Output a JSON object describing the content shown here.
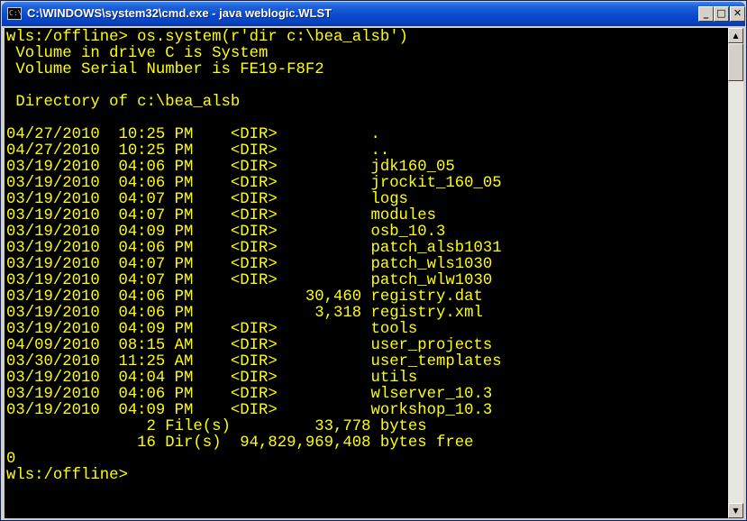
{
  "window": {
    "icon_label": "C:\\",
    "title": "C:\\WINDOWS\\system32\\cmd.exe - java weblogic.WLST",
    "buttons": {
      "minimize": "_",
      "maximize": "□",
      "close": "✕"
    }
  },
  "console": {
    "text_color": "#ffff00",
    "background_color": "#000000",
    "lines": [
      "wls:/offline> os.system(r'dir c:\\bea_alsb')",
      " Volume in drive C is System",
      " Volume Serial Number is FE19-F8F2",
      "",
      " Directory of c:\\bea_alsb",
      "",
      "04/27/2010  10:25 PM    <DIR>          .",
      "04/27/2010  10:25 PM    <DIR>          ..",
      "03/19/2010  04:06 PM    <DIR>          jdk160_05",
      "03/19/2010  04:06 PM    <DIR>          jrockit_160_05",
      "03/19/2010  04:07 PM    <DIR>          logs",
      "03/19/2010  04:07 PM    <DIR>          modules",
      "03/19/2010  04:09 PM    <DIR>          osb_10.3",
      "03/19/2010  04:06 PM    <DIR>          patch_alsb1031",
      "03/19/2010  04:07 PM    <DIR>          patch_wls1030",
      "03/19/2010  04:07 PM    <DIR>          patch_wlw1030",
      "03/19/2010  04:06 PM            30,460 registry.dat",
      "03/19/2010  04:06 PM             3,318 registry.xml",
      "03/19/2010  04:09 PM    <DIR>          tools",
      "04/09/2010  08:15 AM    <DIR>          user_projects",
      "03/30/2010  11:25 AM    <DIR>          user_templates",
      "03/19/2010  04:04 PM    <DIR>          utils",
      "03/19/2010  04:06 PM    <DIR>          wlserver_10.3",
      "03/19/2010  04:09 PM    <DIR>          workshop_10.3",
      "               2 File(s)         33,778 bytes",
      "              16 Dir(s)  94,829,969,408 bytes free",
      "0",
      "wls:/offline> "
    ]
  },
  "scrollbar": {
    "up_arrow": "▲",
    "down_arrow": "▼"
  }
}
